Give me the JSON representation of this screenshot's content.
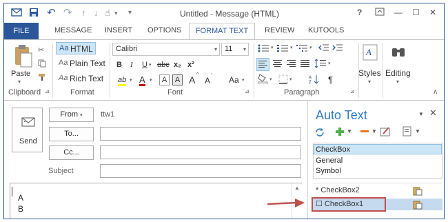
{
  "window": {
    "title": "Untitled - Message (HTML)"
  },
  "title_controls": {
    "help": "?",
    "restore": "□",
    "minimize": "—",
    "maximize": "☐",
    "close": "✕"
  },
  "tabs": [
    {
      "label": "FILE"
    },
    {
      "label": "MESSAGE"
    },
    {
      "label": "INSERT"
    },
    {
      "label": "OPTIONS"
    },
    {
      "label": "FORMAT TEXT"
    },
    {
      "label": "REVIEW"
    },
    {
      "label": "KUTOOLS"
    }
  ],
  "ribbon": {
    "clipboard": {
      "paste": "Paste",
      "group": "Clipboard"
    },
    "format": {
      "html": "HTML",
      "plain": "Plain Text",
      "rich": "Rich Text",
      "prefix": "Aa",
      "group": "Format"
    },
    "font": {
      "name": "Calibri",
      "size": "11",
      "bold": "B",
      "italic": "I",
      "underline": "U",
      "strike": "abc",
      "sub": "x₂",
      "sup": "x²",
      "highlight": "ab",
      "fontcolor": "A",
      "clearfmt": "A",
      "boxedA": "A",
      "grow": "A",
      "shrink": "A",
      "changecase": "Aa",
      "group": "Font"
    },
    "paragraph": {
      "group": "Paragraph"
    },
    "styles": {
      "label": "Styles"
    },
    "editing": {
      "label": "Editing"
    }
  },
  "compose": {
    "send": "Send",
    "from": "From",
    "from_value": "ttw1",
    "to": "To...",
    "cc": "Cc...",
    "subject": "Subject",
    "body_lines": [
      "A",
      "B"
    ]
  },
  "autotext": {
    "title": "Auto Text",
    "categories": [
      "CheckBox",
      "General",
      "Symbol"
    ],
    "entries": [
      {
        "label": "* CheckBox2"
      },
      {
        "label": "☐ CheckBox1"
      }
    ]
  },
  "colors": {
    "accent": "#2b579a",
    "pane_title": "#2b7ac8",
    "selected_row": "#c5d9ef",
    "highlight_callout": "#c0504d"
  }
}
